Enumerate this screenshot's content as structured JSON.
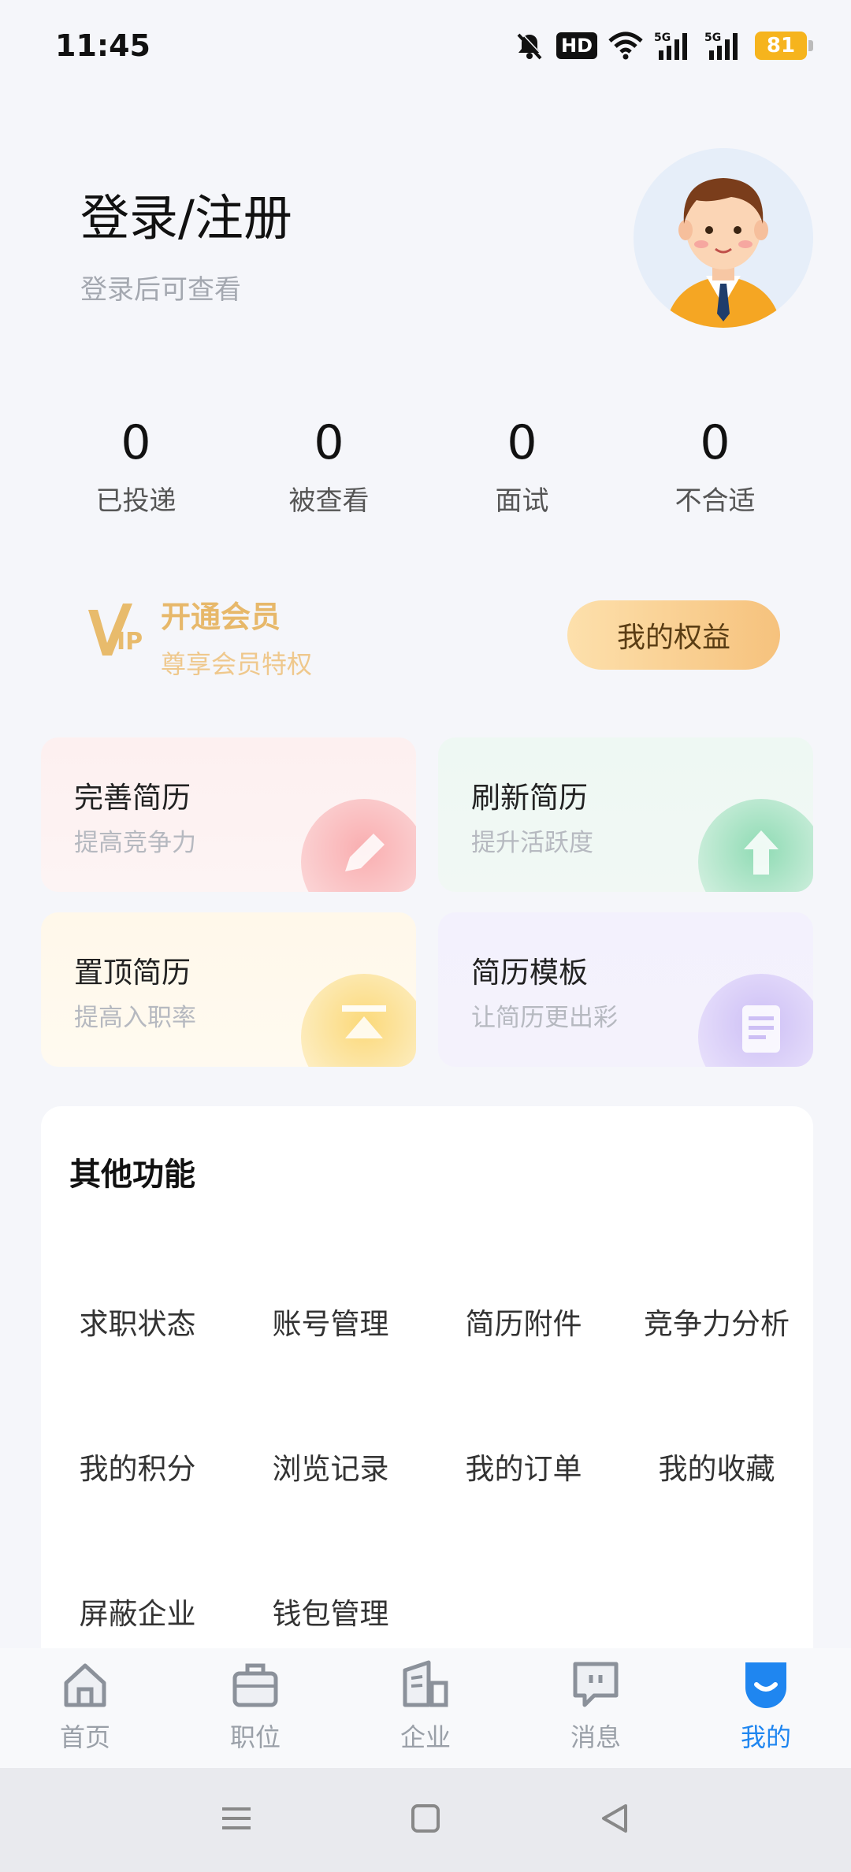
{
  "status_bar": {
    "time": "11:45",
    "hd": "HD",
    "network_1": "5G",
    "network_2": "5G",
    "battery": "81"
  },
  "header": {
    "title": "登录/注册",
    "subtitle": "登录后可查看"
  },
  "stats": [
    {
      "value": "0",
      "label": "已投递"
    },
    {
      "value": "0",
      "label": "被查看"
    },
    {
      "value": "0",
      "label": "面试"
    },
    {
      "value": "0",
      "label": "不合适"
    }
  ],
  "vip": {
    "logo_text": "VIP",
    "title": "开通会员",
    "subtitle": "尊享会员特权",
    "button": "我的权益"
  },
  "cards": [
    {
      "title": "完善简历",
      "subtitle": "提高竞争力",
      "icon": "pencil-icon",
      "color": "#f9b4b6"
    },
    {
      "title": "刷新简历",
      "subtitle": "提升活跃度",
      "icon": "refresh-icon",
      "color": "#8fdbb4"
    },
    {
      "title": "置顶简历",
      "subtitle": "提高入职率",
      "icon": "pin-top-icon",
      "color": "#fbd97a"
    },
    {
      "title": "简历模板",
      "subtitle": "让简历更出彩",
      "icon": "template-icon",
      "color": "#cdbff5"
    }
  ],
  "other": {
    "title": "其他功能",
    "items": [
      "求职状态",
      "账号管理",
      "简历附件",
      "竞争力分析",
      "我的积分",
      "浏览记录",
      "我的订单",
      "我的收藏",
      "屏蔽企业",
      "钱包管理"
    ]
  },
  "tabs": [
    {
      "label": "首页",
      "icon": "home-icon"
    },
    {
      "label": "职位",
      "icon": "briefcase-icon"
    },
    {
      "label": "企业",
      "icon": "building-icon"
    },
    {
      "label": "消息",
      "icon": "message-icon"
    },
    {
      "label": "我的",
      "icon": "profile-icon",
      "active": true
    }
  ],
  "colors": {
    "accent": "#1f86f0",
    "vip_gold": "#e7b86a",
    "background": "#f5f6fa"
  }
}
